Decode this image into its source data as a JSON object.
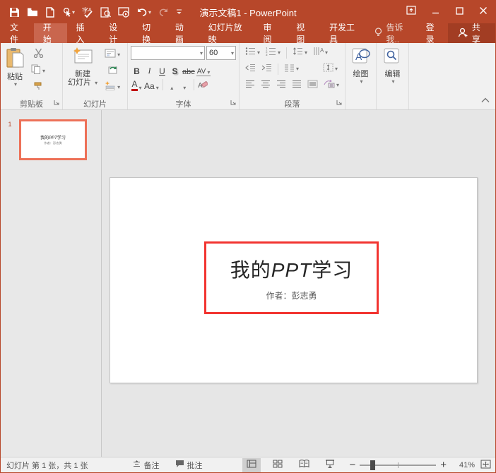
{
  "titlebar": {
    "title": "演示文稿1 - PowerPoint"
  },
  "tabs": [
    {
      "label": "文件"
    },
    {
      "label": "开始",
      "active": true
    },
    {
      "label": "插入"
    },
    {
      "label": "设计"
    },
    {
      "label": "切换"
    },
    {
      "label": "动画"
    },
    {
      "label": "幻灯片放映"
    },
    {
      "label": "审阅"
    },
    {
      "label": "视图"
    },
    {
      "label": "开发工具"
    }
  ],
  "tab_extras": {
    "tellme": "告诉我..",
    "signin": "登录",
    "share": "共享"
  },
  "ribbon": {
    "clipboard": {
      "paste_label": "粘贴",
      "group_label": "剪贴板"
    },
    "slides": {
      "new_slide_line1": "新建",
      "new_slide_line2": "幻灯片",
      "group_label": "幻灯片"
    },
    "font": {
      "name_value": "",
      "size_value": "60",
      "bold": "B",
      "italic": "I",
      "underline": "U",
      "shadow": "S",
      "strike": "abc",
      "spacing": "AV",
      "color_letter": "A",
      "case_label": "Aa",
      "grow_letter": "A",
      "shrink_letter": "A",
      "group_label": "字体"
    },
    "paragraph": {
      "group_label": "段落"
    },
    "drawing": {
      "label": "绘图"
    },
    "editing": {
      "label": "编辑"
    }
  },
  "slide_panel": {
    "slide_number": "1"
  },
  "slide": {
    "title_pre": "我的",
    "title_mid": "PPT",
    "title_post": "学习",
    "subtitle": "作者：彭志勇"
  },
  "statusbar": {
    "slide_info": "幻灯片 第 1 张，共 1 张",
    "notes_label": "备注",
    "comments_label": "批注",
    "zoom_level": "41%"
  },
  "icons": {
    "qat": [
      "save-icon",
      "open-icon",
      "new-file-icon",
      "touch-mode-icon",
      "spelling-icon",
      "print-preview-icon",
      "slideshow-icon",
      "undo-icon",
      "redo-icon",
      "qat-more-icon"
    ],
    "window": [
      "ribbon-display-icon",
      "minimize-icon",
      "maximize-icon",
      "close-icon"
    ],
    "views": [
      "normal-view-icon",
      "slide-sorter-icon",
      "reading-view-icon",
      "slideshow-view-icon"
    ]
  },
  "colors": {
    "titlebar": "#B7472A",
    "active_tab": "#C9664E",
    "share_button": "#A23D23",
    "thumbnail_selection": "#ED7158",
    "annotation_box": "#F23430",
    "ribbon_icon_blue": "#41639F"
  }
}
